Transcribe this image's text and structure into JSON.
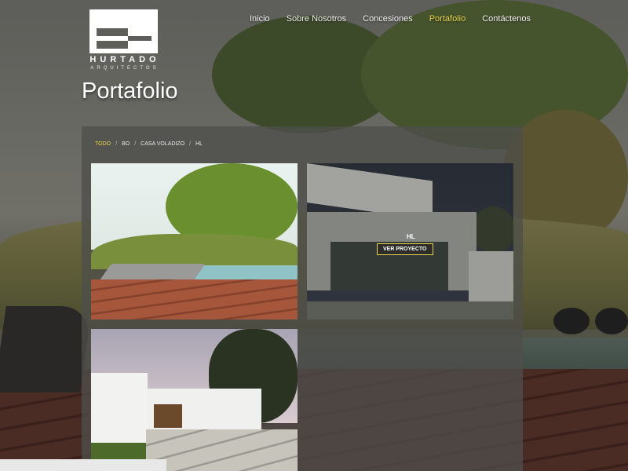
{
  "brand": {
    "name": "HURTADO",
    "tagline": "ARQUITECTOS"
  },
  "nav": {
    "items": [
      {
        "label": "Inicio"
      },
      {
        "label": "Sobre Nosotros"
      },
      {
        "label": "Concesiones"
      },
      {
        "label": "Portafolio"
      },
      {
        "label": "Contáctenos"
      }
    ],
    "active": "Portafolio"
  },
  "page": {
    "title": "Portafolio"
  },
  "filters": {
    "items": [
      "TODO",
      "BO",
      "CASA VOLADIZO",
      "HL"
    ],
    "active": "TODO"
  },
  "projects": [
    {
      "title": "",
      "button": ""
    },
    {
      "title": "HL",
      "button": "VER PROYECTO"
    },
    {
      "title": "",
      "button": ""
    }
  ],
  "colors": {
    "accent": "#e9d64a",
    "panel": "#4e4e4a"
  }
}
